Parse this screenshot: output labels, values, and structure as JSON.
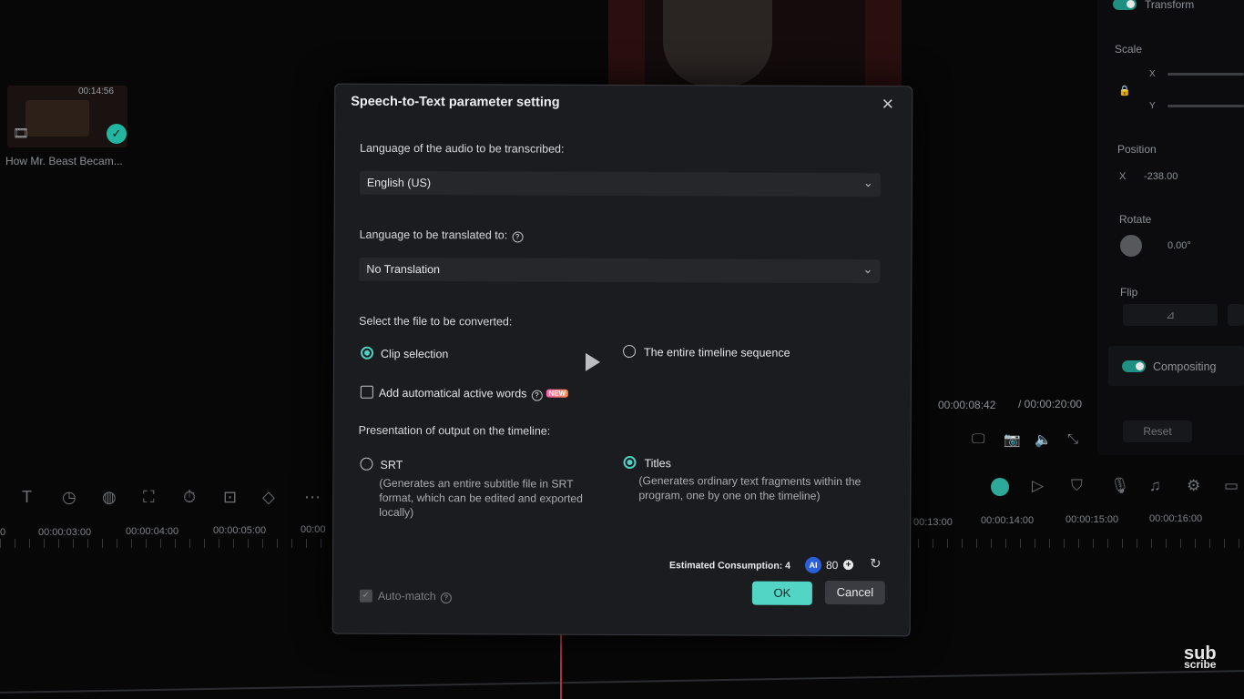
{
  "media": {
    "duration": "00:14:56",
    "name": "How Mr. Beast Becam..."
  },
  "right_panel": {
    "transform_label": "Transform",
    "scale_label": "Scale",
    "scale_x_axis": "X",
    "scale_y_axis": "Y",
    "position_label": "Position",
    "position_x_axis": "X",
    "position_x_value": "-238.00",
    "rotate_label": "Rotate",
    "rotate_value": "0.00°",
    "flip_label": "Flip",
    "compositing_label": "Compositing",
    "reset_label": "Reset"
  },
  "player": {
    "current_time": "00:00:08:42",
    "total_time": "/ 00:00:20:00"
  },
  "timeline": {
    "ruler_labels": [
      "00:00:03:00",
      "00:00:04:00",
      "00:00:05:00",
      "00:00",
      "00:13:00",
      "00:00:14:00",
      "00:00:15:00",
      "00:00:16:00"
    ]
  },
  "dialog": {
    "title": "Speech-to-Text parameter setting",
    "audio_language_label": "Language of the audio to be transcribed:",
    "audio_language_value": "English (US)",
    "translate_label": "Language to be translated to:",
    "translate_value": "No Translation",
    "file_label": "Select the file to be converted:",
    "clip_selection": "Clip selection",
    "entire_timeline": "The entire timeline sequence",
    "active_words": "Add automatical active words",
    "new_badge": "NEW",
    "presentation_label": "Presentation of output on the timeline:",
    "srt_label": "SRT",
    "srt_desc": "(Generates an entire subtitle file in SRT format, which can be edited and exported locally)",
    "titles_label": "Titles",
    "titles_desc": "(Generates ordinary text fragments within the program, one by one on the timeline)",
    "estimated": "Estimated Consumption: 4",
    "ai_badge": "AI",
    "credits": "80",
    "auto_match": "Auto-match",
    "ok_label": "OK",
    "cancel_label": "Cancel"
  },
  "watermark": {
    "line1": "sub",
    "line2": "scribe"
  },
  "colors": {
    "accent": "#4fd1c5",
    "ok_button": "#53d5c5",
    "dialog_bg": "#1b1c1f"
  },
  "icons": {
    "close": "close-icon",
    "chevron": "chevron-down-icon",
    "help": "help-icon",
    "refresh": "refresh-icon"
  }
}
